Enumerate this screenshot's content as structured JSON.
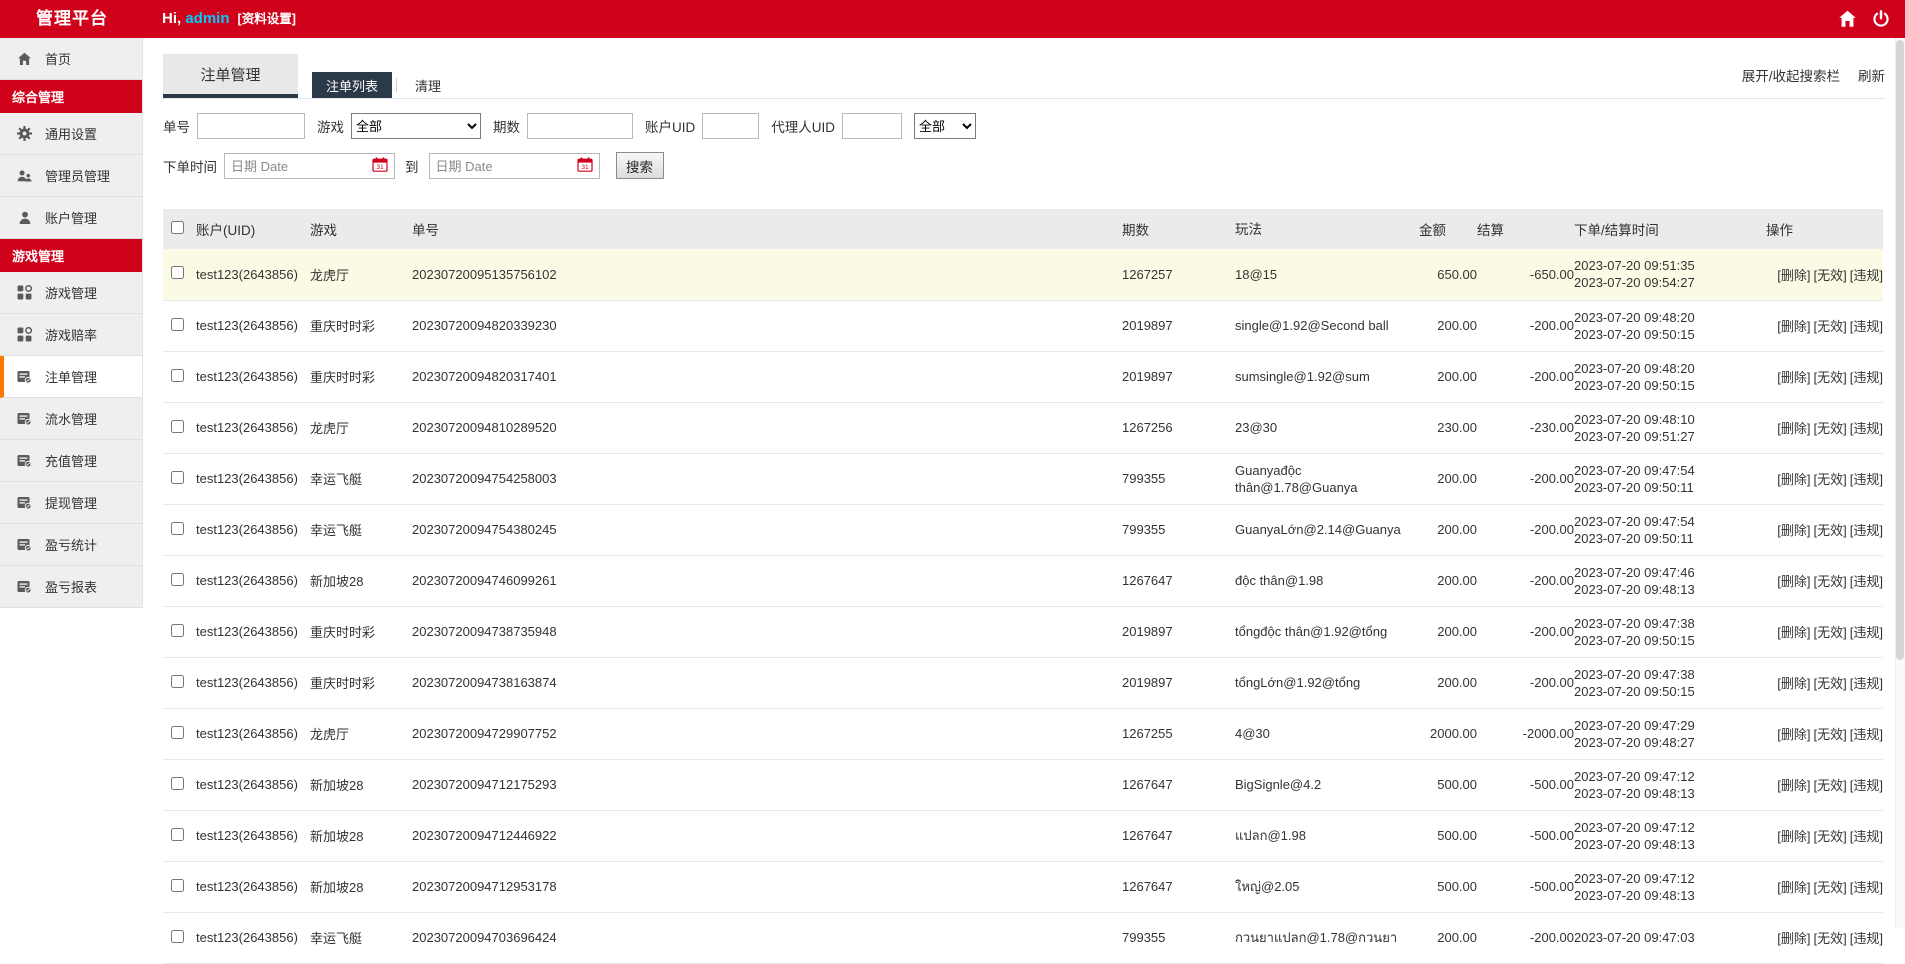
{
  "header": {
    "brand": "管理平台",
    "greeting_prefix": "Hi, ",
    "username": "admin",
    "profile_link": "[资料设置]",
    "icons": [
      "home-icon",
      "power-icon"
    ]
  },
  "sidebar": {
    "items": [
      {
        "type": "item",
        "label": "首页",
        "icon": "home-icon"
      },
      {
        "type": "section",
        "label": "综合管理"
      },
      {
        "type": "item",
        "label": "通用设置",
        "icon": "gear-icon"
      },
      {
        "type": "item",
        "label": "管理员管理",
        "icon": "admins-icon"
      },
      {
        "type": "item",
        "label": "账户管理",
        "icon": "user-icon"
      },
      {
        "type": "section",
        "label": "游戏管理"
      },
      {
        "type": "item",
        "label": "游戏管理",
        "icon": "grid-icon"
      },
      {
        "type": "item",
        "label": "游戏赔率",
        "icon": "grid-icon"
      },
      {
        "type": "item",
        "label": "注单管理",
        "icon": "card-icon",
        "active": true
      },
      {
        "type": "item",
        "label": "流水管理",
        "icon": "card-icon"
      },
      {
        "type": "item",
        "label": "充值管理",
        "icon": "card-icon"
      },
      {
        "type": "item",
        "label": "提现管理",
        "icon": "card-icon"
      },
      {
        "type": "item",
        "label": "盈亏统计",
        "icon": "card-icon"
      },
      {
        "type": "item",
        "label": "盈亏报表",
        "icon": "card-icon"
      }
    ]
  },
  "page": {
    "title": "注单管理",
    "tabs": [
      {
        "label": "注单列表",
        "active": true
      },
      {
        "label": "清理",
        "active": false
      }
    ],
    "toolbar_links": [
      "展开/收起搜索栏",
      "刷新"
    ]
  },
  "filters": {
    "order_no_label": "单号",
    "game_label": "游戏",
    "game_value": "全部",
    "period_label": "期数",
    "account_uid_label": "账户UID",
    "agent_uid_label": "代理人UID",
    "status_value": "全部",
    "time_label": "下单时间",
    "to_label": "到",
    "date_placeholder": "日期 Date",
    "search_button": "搜索",
    "calendar_icon": "calendar-icon"
  },
  "table": {
    "columns": [
      "账户(UID)",
      "游戏",
      "单号",
      "期数",
      "玩法",
      "金额",
      "结算",
      "下单/结算时间",
      "操作"
    ],
    "action_labels": [
      "[删除]",
      "[无效]",
      "[违规]"
    ],
    "rows": [
      {
        "account": "test123(2643856)",
        "game": "龙虎厅",
        "order_no": "20230720095135756102",
        "period": "1267257",
        "play": "18@15",
        "amount": "650.00",
        "settle": "-650.00",
        "time1": "2023-07-20 09:51:35",
        "time2": "2023-07-20 09:54:27",
        "highlight": true
      },
      {
        "account": "test123(2643856)",
        "game": "重庆时时彩",
        "order_no": "20230720094820339230",
        "period": "2019897",
        "play": "single@1.92@Second ball",
        "amount": "200.00",
        "settle": "-200.00",
        "time1": "2023-07-20 09:48:20",
        "time2": "2023-07-20 09:50:15"
      },
      {
        "account": "test123(2643856)",
        "game": "重庆时时彩",
        "order_no": "20230720094820317401",
        "period": "2019897",
        "play": "sumsingle@1.92@sum",
        "amount": "200.00",
        "settle": "-200.00",
        "time1": "2023-07-20 09:48:20",
        "time2": "2023-07-20 09:50:15"
      },
      {
        "account": "test123(2643856)",
        "game": "龙虎厅",
        "order_no": "20230720094810289520",
        "period": "1267256",
        "play": "23@30",
        "amount": "230.00",
        "settle": "-230.00",
        "time1": "2023-07-20 09:48:10",
        "time2": "2023-07-20 09:51:27"
      },
      {
        "account": "test123(2643856)",
        "game": "幸运飞艇",
        "order_no": "20230720094754258003",
        "period": "799355",
        "play": "Guanyađộc thân@1.78@Guanya",
        "amount": "200.00",
        "settle": "-200.00",
        "time1": "2023-07-20 09:47:54",
        "time2": "2023-07-20 09:50:11"
      },
      {
        "account": "test123(2643856)",
        "game": "幸运飞艇",
        "order_no": "20230720094754380245",
        "period": "799355",
        "play": "GuanyaLớn@2.14@Guanya",
        "amount": "200.00",
        "settle": "-200.00",
        "time1": "2023-07-20 09:47:54",
        "time2": "2023-07-20 09:50:11"
      },
      {
        "account": "test123(2643856)",
        "game": "新加坡28",
        "order_no": "20230720094746099261",
        "period": "1267647",
        "play": "độc thân@1.98",
        "amount": "200.00",
        "settle": "-200.00",
        "time1": "2023-07-20 09:47:46",
        "time2": "2023-07-20 09:48:13"
      },
      {
        "account": "test123(2643856)",
        "game": "重庆时时彩",
        "order_no": "20230720094738735948",
        "period": "2019897",
        "play": "tổngđộc thân@1.92@tổng",
        "amount": "200.00",
        "settle": "-200.00",
        "time1": "2023-07-20 09:47:38",
        "time2": "2023-07-20 09:50:15"
      },
      {
        "account": "test123(2643856)",
        "game": "重庆时时彩",
        "order_no": "20230720094738163874",
        "period": "2019897",
        "play": "tổngLớn@1.92@tổng",
        "amount": "200.00",
        "settle": "-200.00",
        "time1": "2023-07-20 09:47:38",
        "time2": "2023-07-20 09:50:15"
      },
      {
        "account": "test123(2643856)",
        "game": "龙虎厅",
        "order_no": "20230720094729907752",
        "period": "1267255",
        "play": "4@30",
        "amount": "2000.00",
        "settle": "-2000.00",
        "time1": "2023-07-20 09:47:29",
        "time2": "2023-07-20 09:48:27"
      },
      {
        "account": "test123(2643856)",
        "game": "新加坡28",
        "order_no": "20230720094712175293",
        "period": "1267647",
        "play": "BigSignle@4.2",
        "amount": "500.00",
        "settle": "-500.00",
        "time1": "2023-07-20 09:47:12",
        "time2": "2023-07-20 09:48:13"
      },
      {
        "account": "test123(2643856)",
        "game": "新加坡28",
        "order_no": "20230720094712446922",
        "period": "1267647",
        "play": "แปลก@1.98",
        "amount": "500.00",
        "settle": "-500.00",
        "time1": "2023-07-20 09:47:12",
        "time2": "2023-07-20 09:48:13"
      },
      {
        "account": "test123(2643856)",
        "game": "新加坡28",
        "order_no": "20230720094712953178",
        "period": "1267647",
        "play": "ใหญ่@2.05",
        "amount": "500.00",
        "settle": "-500.00",
        "time1": "2023-07-20 09:47:12",
        "time2": "2023-07-20 09:48:13"
      },
      {
        "account": "test123(2643856)",
        "game": "幸运飞艇",
        "order_no": "20230720094703696424",
        "period": "799355",
        "play": "กวนยาแปลก@1.78@กวนยา",
        "amount": "200.00",
        "settle": "-200.00",
        "time1": "2023-07-20 09:47:03",
        "time2": ""
      }
    ]
  },
  "colors": {
    "brand_red": "#d0021b",
    "navy": "#2b3948",
    "active_orange": "#ff7800",
    "username_cyan": "#00ccff",
    "highlight_row": "#fbfbe5"
  }
}
